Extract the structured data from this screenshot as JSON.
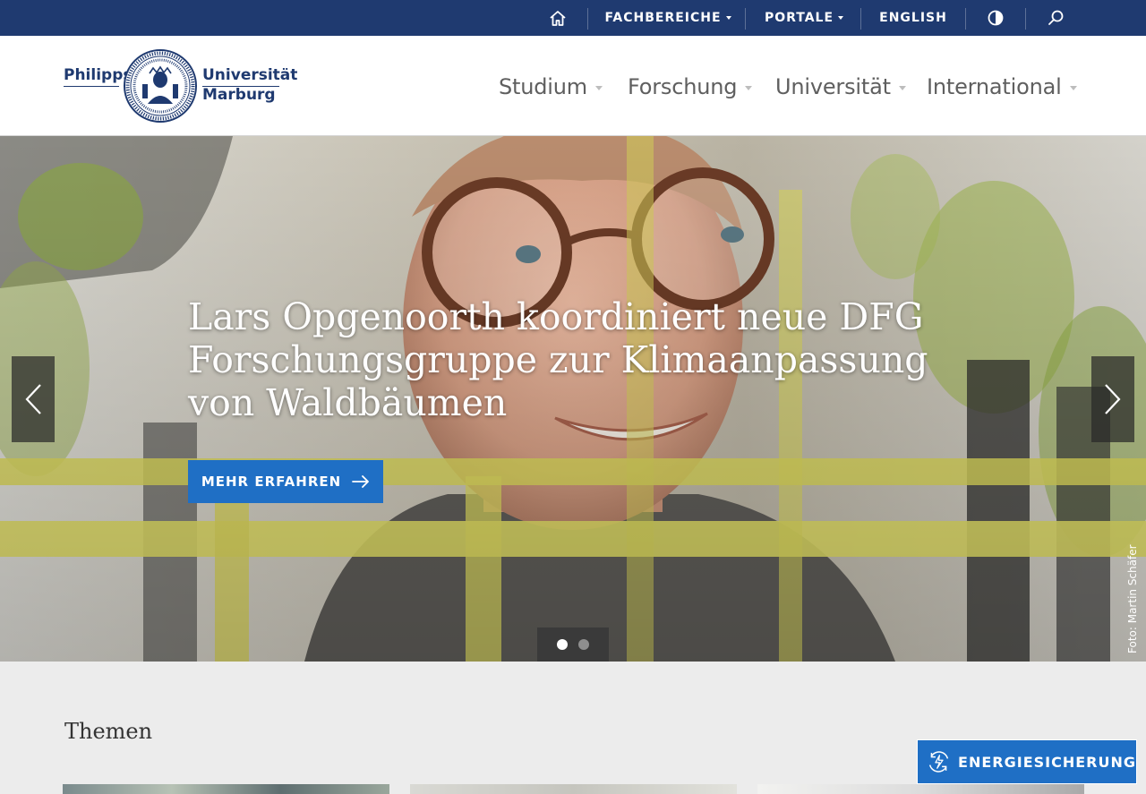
{
  "topbar": {
    "home_icon": "home-icon",
    "fachbereiche": "FACHBEREICHE",
    "portale": "PORTALE",
    "english": "ENGLISH",
    "contrast_icon": "contrast-icon",
    "search_icon": "search-icon"
  },
  "logo": {
    "word1": "Philipps",
    "word2": "Universität",
    "word3": "Marburg"
  },
  "nav": {
    "items": [
      {
        "label": "Studium"
      },
      {
        "label": "Forschung"
      },
      {
        "label": "Universität"
      },
      {
        "label": "International"
      }
    ]
  },
  "hero": {
    "headline": "Lars Opgenoorth koordiniert neue DFG Forschungsgruppe zur Klimaanpassung von Waldbäumen",
    "cta_label": "MEHR ERFAHREN",
    "credit": "Foto: Martin Schäfer",
    "slide_count": 2,
    "active_slide": 1
  },
  "themen": {
    "title": "Themen"
  },
  "energy_button": {
    "label": "ENERGIESICHERUNG",
    "icon": "energy-icon"
  },
  "colors": {
    "topbar": "#1f3a70",
    "accent": "#1f6fc5",
    "nav_text": "#5f5f5f"
  }
}
